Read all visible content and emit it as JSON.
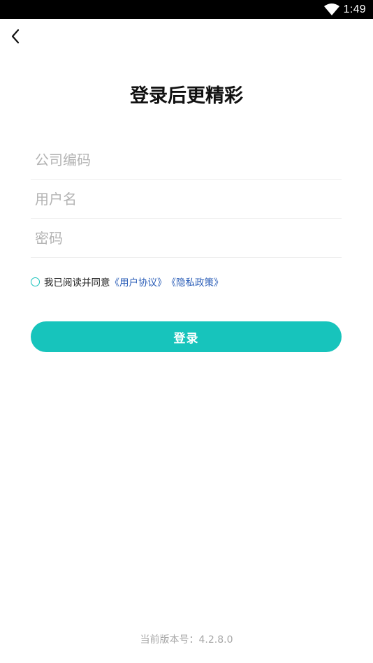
{
  "status_bar": {
    "time": "1:49",
    "wifi_icon": "wifi-icon"
  },
  "nav": {
    "back_icon": "chevron-left-icon"
  },
  "title": "登录后更精彩",
  "form": {
    "company_code_placeholder": "公司编码",
    "username_placeholder": "用户名",
    "password_placeholder": "密码",
    "company_code_value": "",
    "username_value": "",
    "password_value": ""
  },
  "agreement": {
    "checked": false,
    "text": "我已阅读并同意",
    "user_agreement": "《用户协议》",
    "privacy_policy": "《隐私政策》"
  },
  "login_button": "登录",
  "version_text": "当前版本号：4.2.8.0",
  "colors": {
    "accent": "#17c4bc",
    "link": "#2a5db7",
    "placeholder": "#b3b3b3"
  }
}
